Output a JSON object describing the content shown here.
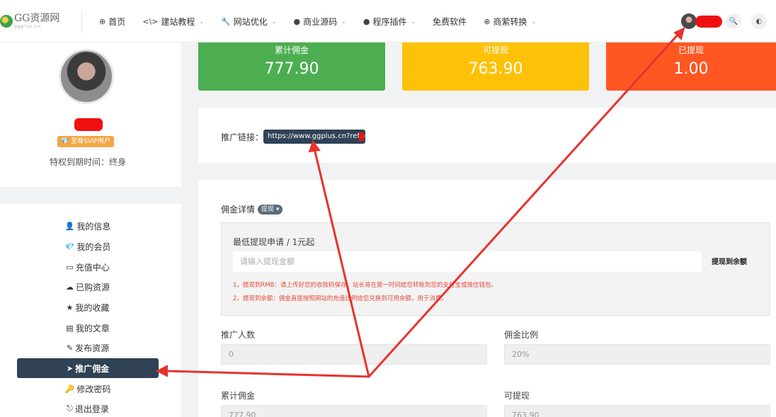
{
  "header": {
    "logo": {
      "main": "GG资源网",
      "sub": "ggplus.cn"
    },
    "nav": [
      {
        "icon": "⊕",
        "label": "首页",
        "dropdown": false
      },
      {
        "icon": "<\\>",
        "label": "建站教程",
        "dropdown": true
      },
      {
        "icon": "🔧",
        "label": "网站优化",
        "dropdown": true
      },
      {
        "icon": "●",
        "label": "商业源码",
        "dropdown": true
      },
      {
        "icon": "●",
        "label": "程序插件",
        "dropdown": true
      },
      {
        "icon": "",
        "label": "免费软件",
        "dropdown": false
      },
      {
        "icon": "⊕",
        "label": "商萦转换",
        "dropdown": true
      }
    ],
    "icons": {
      "search": "🔍",
      "theme": "◐"
    }
  },
  "profile": {
    "vip_badge": "💎 至尊SVIP用户",
    "expire_text": "特权到期时间：终身"
  },
  "menu": [
    {
      "icon": "👤",
      "label": "我的信息",
      "active": false
    },
    {
      "icon": "💎",
      "label": "我的会员",
      "active": false
    },
    {
      "icon": "▭",
      "label": "充值中心",
      "active": false
    },
    {
      "icon": "☁",
      "label": "已购资源",
      "active": false
    },
    {
      "icon": "★",
      "label": "我的收藏",
      "active": false
    },
    {
      "icon": "▤",
      "label": "我的文章",
      "active": false
    },
    {
      "icon": "✎",
      "label": "发布资源",
      "active": false
    },
    {
      "icon": "➤",
      "label": "推广佣金",
      "active": true
    },
    {
      "icon": "🔑",
      "label": "修改密码",
      "active": false
    },
    {
      "icon": "⎋",
      "label": "退出登录",
      "active": false
    }
  ],
  "stats": [
    {
      "label": "累计佣金",
      "value": "777.90",
      "color": "#4cae50"
    },
    {
      "label": "可提现",
      "value": "763.90",
      "color": "#fdc107"
    },
    {
      "label": "已提现",
      "value": "1.00",
      "color": "#fe5722"
    }
  ],
  "promo": {
    "label": "推广链接：",
    "url": "https://www.ggplus.cn?ref="
  },
  "details": {
    "title": "佣金详情",
    "pill": "提现 ▾",
    "withdraw_title": "最低提现申请 / 1元起",
    "input_placeholder": "请输入提现金额",
    "withdraw_button": "提现到余额",
    "note1": "1，提现到RMB：请上传好您的收款码保存，站长将在第一时间给您转账到您的支付宝或微信钱包。",
    "note2": "2，提现到余额：佣金直接按照网站的充值比例给您兑换到可用余额，用于消费。",
    "fields": [
      {
        "label": "推广人数",
        "value": "0"
      },
      {
        "label": "佣金比例",
        "value": "20%"
      },
      {
        "label": "累计佣金",
        "value": "777.90"
      },
      {
        "label": "可提现",
        "value": "763.90"
      }
    ]
  },
  "colors": {
    "dark": "#2f4256",
    "annotation": "#e8322d",
    "redaction": "#f01010"
  }
}
